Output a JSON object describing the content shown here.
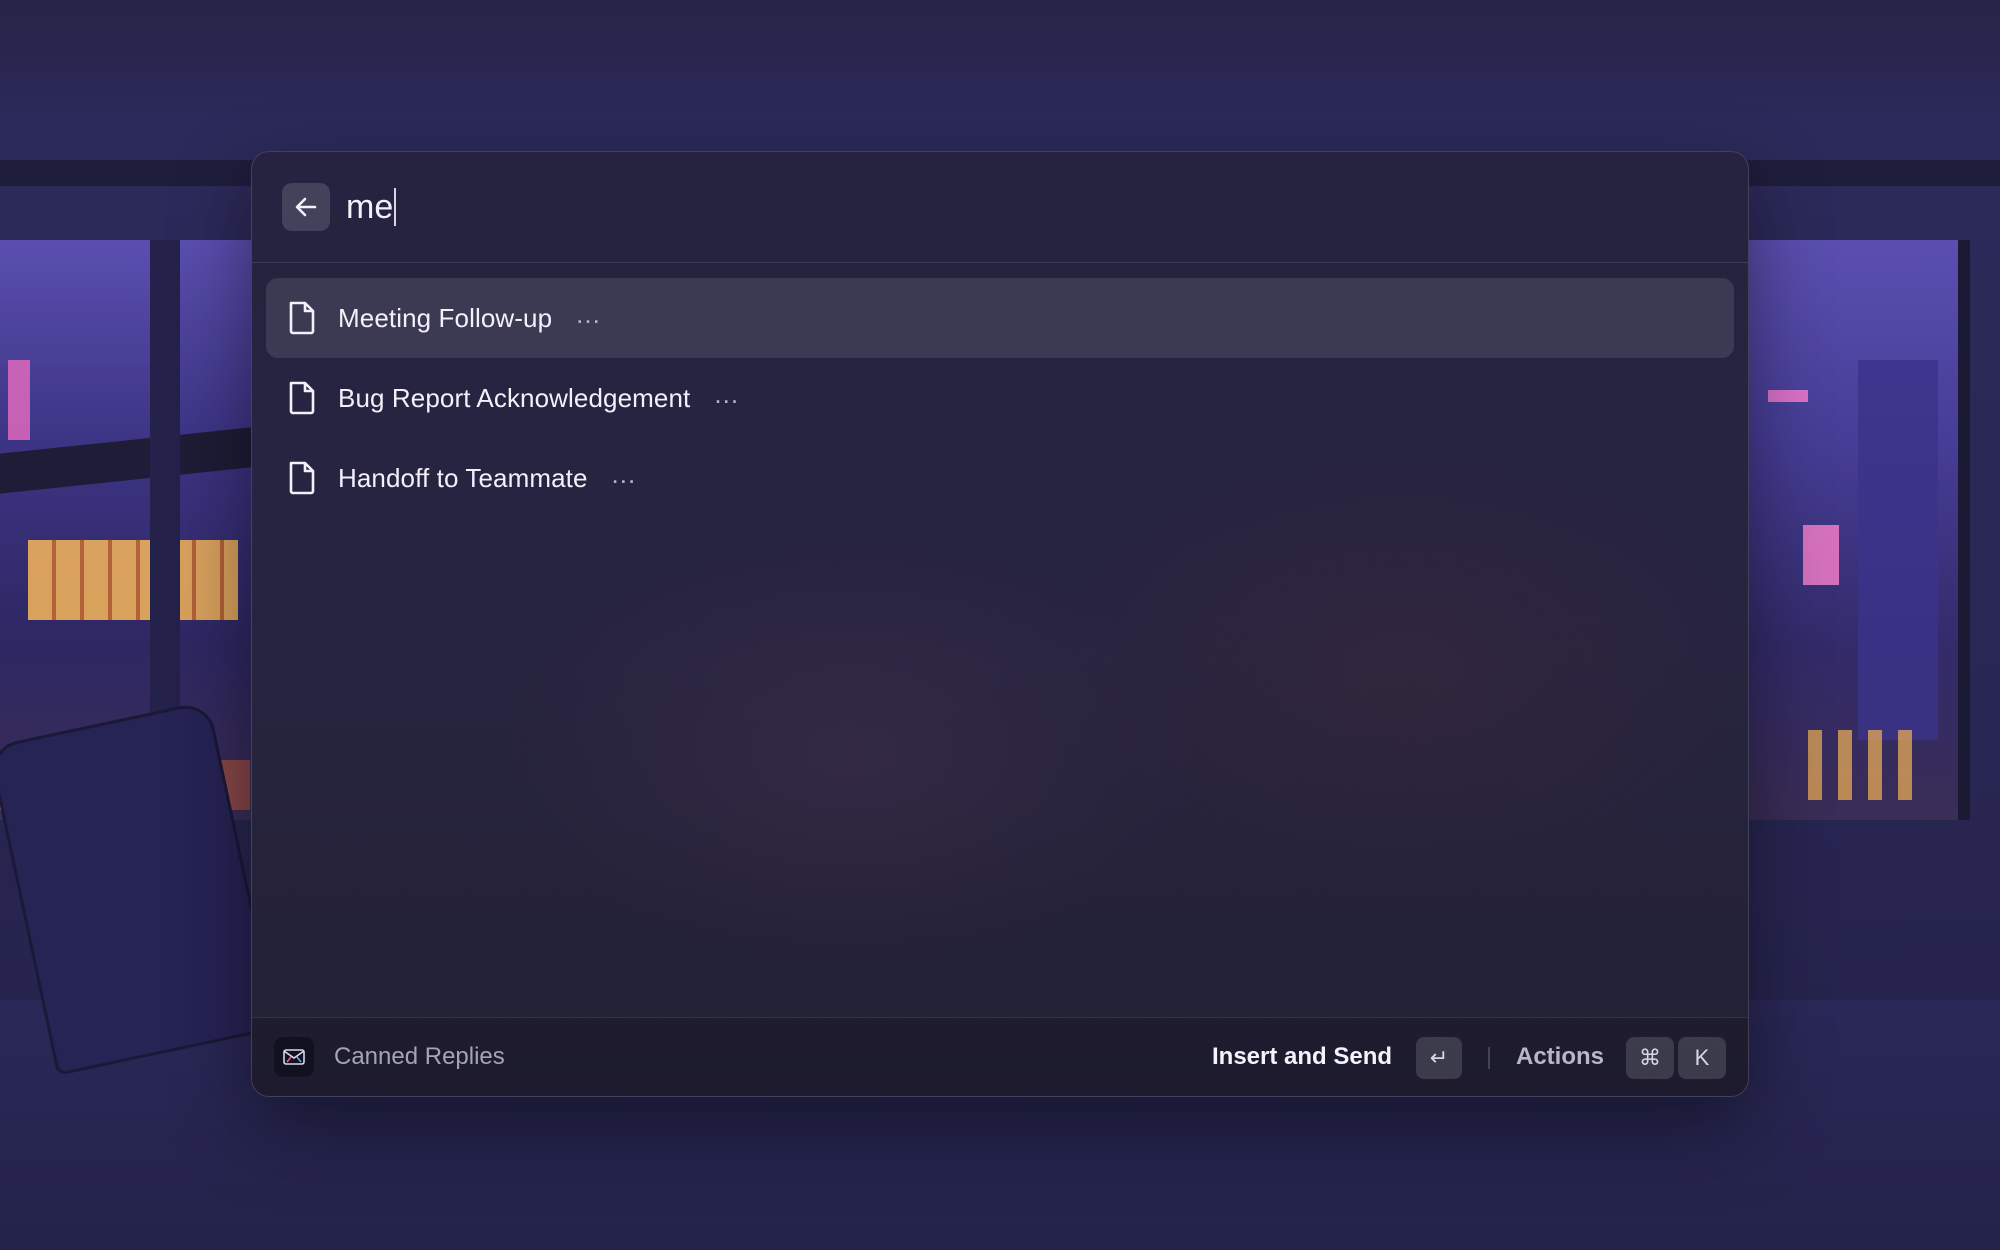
{
  "search": {
    "query": "me"
  },
  "results": [
    {
      "title": "Meeting Follow-up",
      "more": "...",
      "selected": true
    },
    {
      "title": "Bug Report Acknowledgement",
      "more": "...",
      "selected": false
    },
    {
      "title": "Handoff to Teammate",
      "more": "...",
      "selected": false
    }
  ],
  "footer": {
    "extension_name": "Canned Replies",
    "primary_action_label": "Insert and Send",
    "primary_action_key": "↵",
    "actions_label": "Actions",
    "actions_keys": [
      "⌘",
      "K"
    ]
  },
  "icons": {
    "back": "arrow-left-icon",
    "result": "document-icon",
    "extension": "canned-replies-icon"
  }
}
